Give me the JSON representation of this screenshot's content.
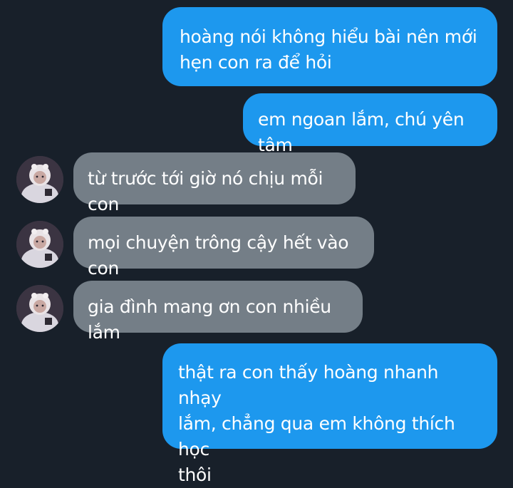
{
  "colors": {
    "background": "#18202a",
    "outgoing_bubble": "#1d98ee",
    "incoming_bubble": "#747e87",
    "text": "#ffffff"
  },
  "messages": [
    {
      "direction": "outgoing",
      "text": "hoàng nói không hiểu bài nên mới\nhẹn con ra để hỏi"
    },
    {
      "direction": "outgoing",
      "text": "em ngoan lắm, chú yên tâm"
    },
    {
      "direction": "incoming",
      "avatar": "contact-avatar-icon",
      "text": "từ trước tới giờ nó chịu mỗi con"
    },
    {
      "direction": "incoming",
      "avatar": "contact-avatar-icon",
      "text": "mọi chuyện trông cậy hết vào con"
    },
    {
      "direction": "incoming",
      "avatar": "contact-avatar-icon",
      "text": "gia đình mang ơn con nhiều lắm"
    },
    {
      "direction": "outgoing",
      "text": "thật ra con thấy hoàng nhanh nhạy\nlắm, chẳng qua em không thích học\nthôi"
    }
  ]
}
